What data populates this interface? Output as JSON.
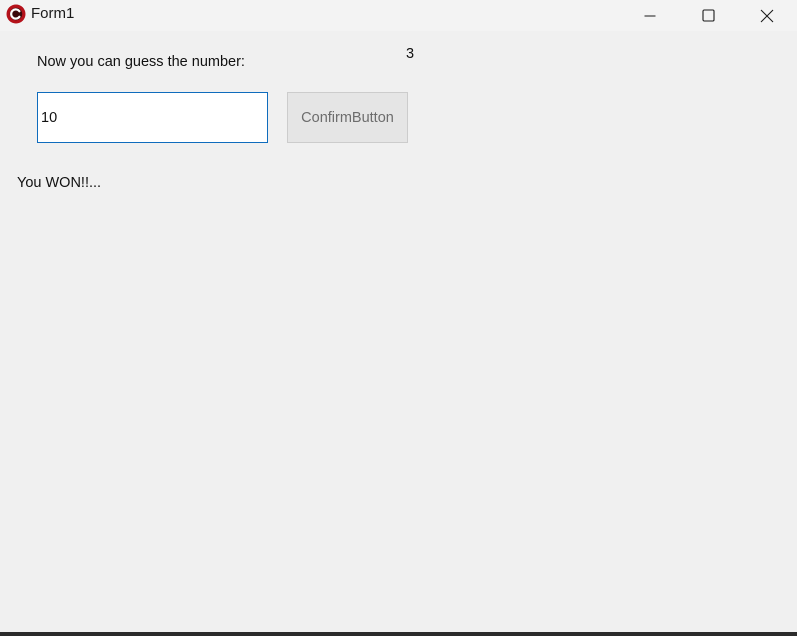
{
  "window": {
    "title": "Form1",
    "icon": "app-c-icon",
    "controls": {
      "minimize_icon": "minimize-icon",
      "maximize_icon": "maximize-icon",
      "close_icon": "close-icon"
    }
  },
  "form": {
    "prompt_label": "Now you can guess the number:",
    "counter_value": "3",
    "guess_input_value": "10",
    "confirm_button_label": "ConfirmButton",
    "result_label": "You WON!!..."
  },
  "colors": {
    "window_background": "#f0f0f0",
    "titlebar_background": "#f3f3f3",
    "input_border_focus": "#0f6cbd",
    "button_background": "#e5e5e5",
    "button_text": "#6d6d6d",
    "app_icon_red": "#b5121b"
  }
}
